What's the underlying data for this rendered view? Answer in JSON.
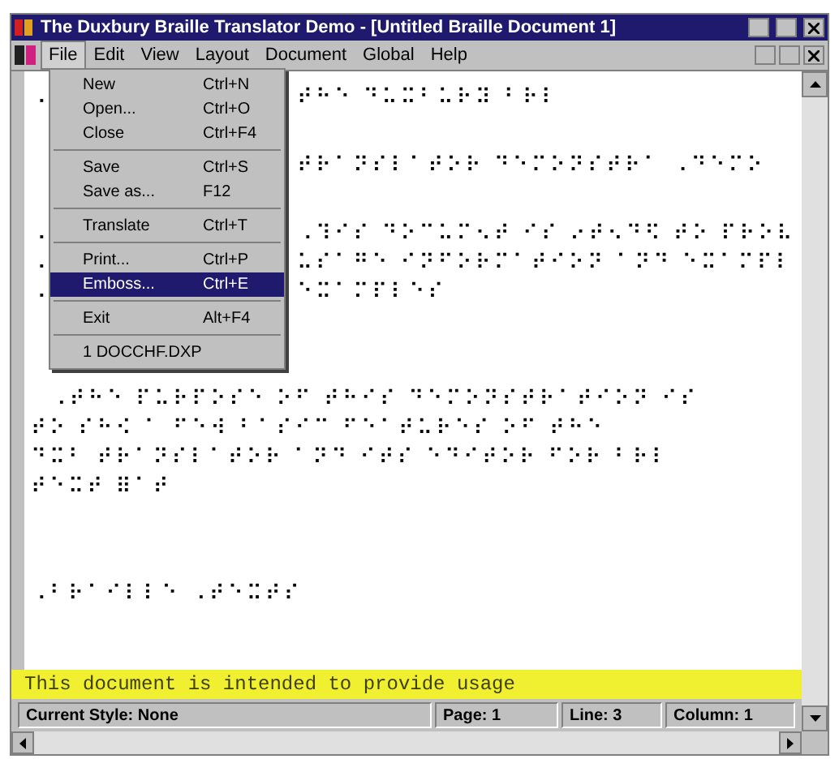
{
  "window": {
    "title": "The Duxbury Braille Translator Demo - [Untitled Braille Document 1]"
  },
  "menu_bar": [
    {
      "label": "File",
      "selected": true
    },
    {
      "label": "Edit",
      "selected": false
    },
    {
      "label": "View",
      "selected": false
    },
    {
      "label": "Layout",
      "selected": false
    },
    {
      "label": "Document",
      "selected": false
    },
    {
      "label": "Global",
      "selected": false
    },
    {
      "label": "Help",
      "selected": false
    }
  ],
  "file_menu": [
    {
      "kind": "item",
      "label": "New",
      "shortcut": "Ctrl+N",
      "selected": false
    },
    {
      "kind": "item",
      "label": "Open...",
      "shortcut": "Ctrl+O",
      "selected": false
    },
    {
      "kind": "item",
      "label": "Close",
      "shortcut": "Ctrl+F4",
      "selected": false
    },
    {
      "kind": "separator"
    },
    {
      "kind": "item",
      "label": "Save",
      "shortcut": "Ctrl+S",
      "selected": false
    },
    {
      "kind": "item",
      "label": "Save as...",
      "shortcut": "F12",
      "selected": false
    },
    {
      "kind": "separator"
    },
    {
      "kind": "item",
      "label": "Translate",
      "shortcut": "Ctrl+T",
      "selected": false
    },
    {
      "kind": "separator"
    },
    {
      "kind": "item",
      "label": "Print...",
      "shortcut": "Ctrl+P",
      "selected": false
    },
    {
      "kind": "item",
      "label": "Emboss...",
      "shortcut": "Ctrl+E",
      "selected": true
    },
    {
      "kind": "separator"
    },
    {
      "kind": "item",
      "label": "Exit",
      "shortcut": "Alt+F4",
      "selected": false
    },
    {
      "kind": "separator"
    },
    {
      "kind": "item",
      "label": "1 DOCCHF.DXP",
      "selected": false
    }
  ],
  "document_lines_beside_menu": [
    {
      "kind": "text",
      "left": "⠠",
      "text": "⠞⠓⠑ ⠙⠥⠭⠃⠥⠗⠽ ⠃⠗⠇"
    },
    {
      "kind": "blank"
    },
    {
      "kind": "text",
      "text": "⠞⠗⠁⠝⠎⠇⠁⠞⠕⠗ ⠙⠑⠍⠕⠝⠎⠞⠗⠁ ⠠⠙⠑⠍⠕"
    },
    {
      "kind": "blank"
    },
    {
      "kind": "text",
      "left": "⠠",
      "text": "⠠⠹⠊⠎ ⠙⠕⠉⠥⠍⠢⠞ ⠊⠎ ⠔⠞⠢⠙⠫ ⠞⠕ ⠏⠗⠕⠧"
    },
    {
      "kind": "text",
      "left": "⠠",
      "text": "⠥⠎⠁⠛⠑ ⠊⠝⠋⠕⠗⠍⠁⠞⠊⠕⠝ ⠁⠝⠙ ⠑⠭⠁⠍⠏⠇"
    },
    {
      "kind": "text",
      "left": "⠠",
      "text": "⠑⠭⠁⠍⠏⠇⠑⠎"
    },
    {
      "kind": "blank"
    },
    {
      "kind": "blank"
    }
  ],
  "document_lines": [
    {
      "kind": "text",
      "text": "  ⠠⠞⠓⠑ ⠏⠥⠗⠏⠕⠎⠑ ⠕⠋ ⠞⠓⠊⠎ ⠙⠑⠍⠕⠝⠎⠞⠗⠁⠞⠊⠕⠝ ⠊⠎"
    },
    {
      "kind": "text",
      "text": "⠞⠕ ⠎⠓⠪ ⠁ ⠋⠑⠺ ⠃⠁⠎⠊⠉ ⠋⠑⠁⠞⠥⠗⠑⠎ ⠕⠋ ⠞⠓⠑"
    },
    {
      "kind": "text",
      "text": "⠙⠭⠃ ⠞⠗⠁⠝⠎⠇⠁⠞⠕⠗ ⠁⠝⠙ ⠊⠞⠎ ⠑⠙⠊⠞⠕⠗ ⠋⠕⠗ ⠃⠗⠇"
    },
    {
      "kind": "text",
      "text": "⠞⠑⠭⠞ ⠿⠁⠞"
    },
    {
      "kind": "blank"
    },
    {
      "kind": "blank"
    },
    {
      "kind": "text",
      "text": "⠠⠃⠗⠁⠊⠇⠇⠑ ⠠⠞⠑⠭⠞⠎"
    }
  ],
  "preview_line": "This document is intended to provide usage",
  "status_bar": [
    "Current Style: None",
    "Page: 1",
    "Line: 3",
    "Column: 1"
  ]
}
